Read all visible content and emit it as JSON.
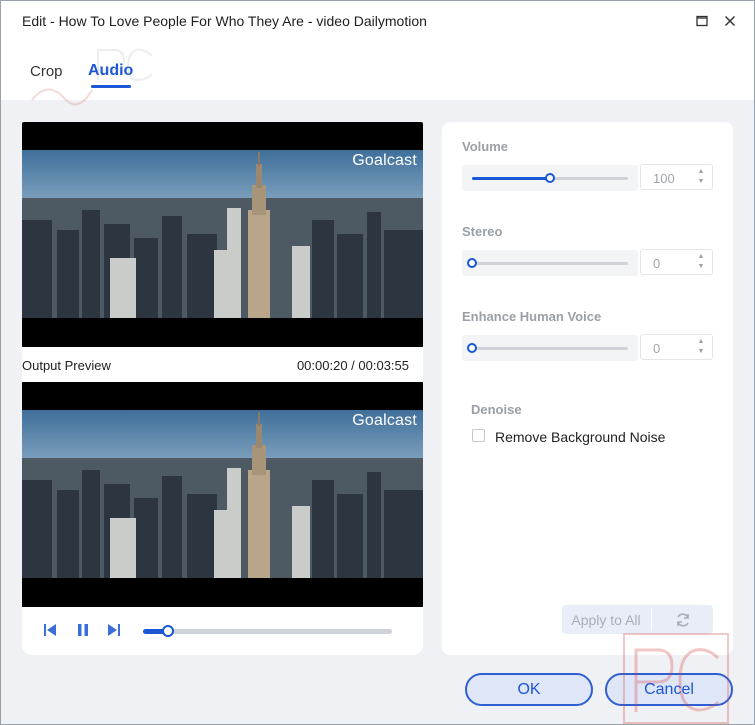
{
  "window": {
    "title": "Edit - How To Love People For Who They Are - video Dailymotion",
    "maximize_icon": "maximize-icon",
    "close_icon": "close-icon"
  },
  "tabs": [
    {
      "label": "Crop",
      "active": false
    },
    {
      "label": "Audio",
      "active": true
    }
  ],
  "preview": {
    "watermark_text": "Goalcast",
    "output_label": "Output Preview",
    "timecode": "00:00:20 / 00:03:55",
    "progress_fraction": 0.1
  },
  "player": {
    "prev_icon": "skip-previous-icon",
    "pause_icon": "pause-icon",
    "next_icon": "skip-next-icon"
  },
  "settings": {
    "volume": {
      "label": "Volume",
      "value": "100",
      "fraction": 0.5
    },
    "stereo": {
      "label": "Stereo",
      "value": "0",
      "fraction": 0.0
    },
    "enhance": {
      "label": "Enhance Human Voice",
      "value": "0",
      "fraction": 0.0
    },
    "denoise": {
      "label": "Denoise",
      "checkbox_label": "Remove Background Noise",
      "checked": false
    }
  },
  "actions": {
    "apply_all": "Apply to All",
    "refresh_icon": "refresh-icon",
    "ok": "OK",
    "cancel": "Cancel"
  },
  "colors": {
    "accent": "#1a56d6",
    "panel_bg": "#f0f1f4",
    "disabled_text": "#9aa0a8"
  }
}
